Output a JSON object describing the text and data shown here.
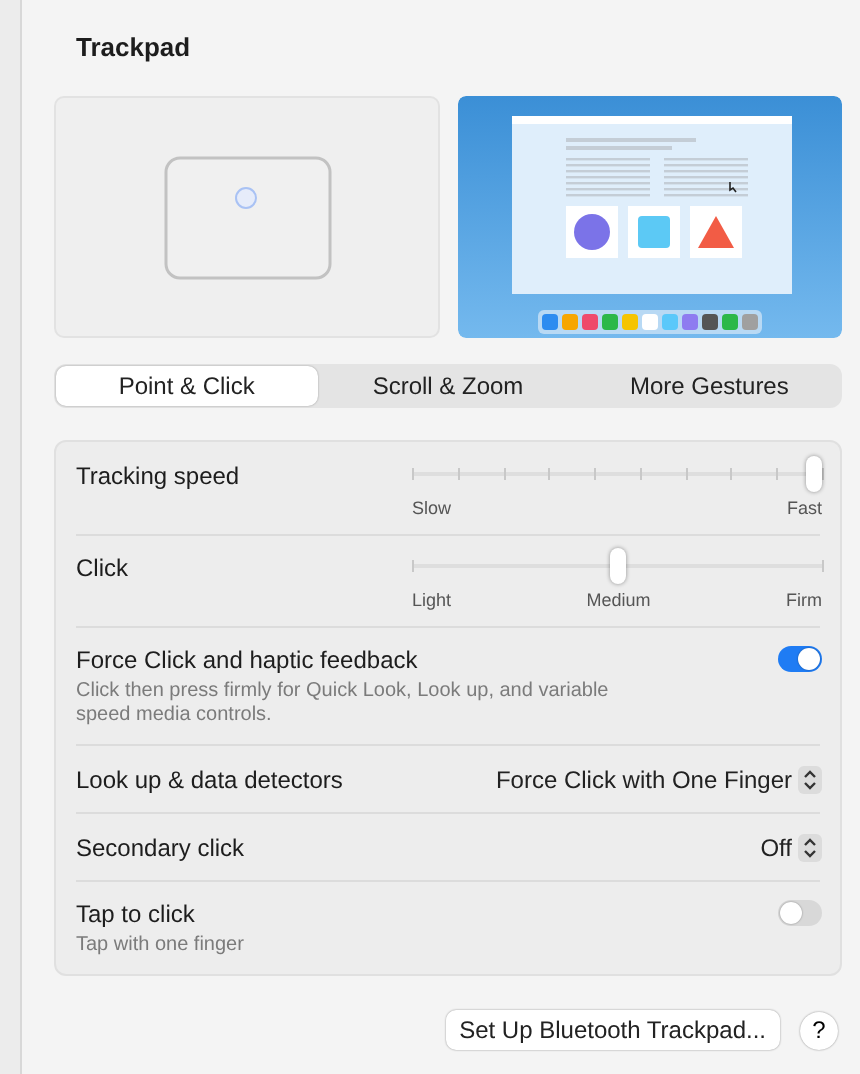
{
  "title": "Trackpad",
  "tabs": [
    {
      "label": "Point & Click",
      "selected": true
    },
    {
      "label": "Scroll & Zoom",
      "selected": false
    },
    {
      "label": "More Gestures",
      "selected": false
    }
  ],
  "settings": [
    {
      "kind": "slider",
      "label": "Tracking speed",
      "level": 1,
      "scale": [
        "Slow",
        "Fast"
      ]
    },
    {
      "kind": "slider",
      "label": "Click",
      "level": 0.5,
      "scale": [
        "Light",
        "Medium",
        "Firm"
      ]
    },
    {
      "kind": "toggle",
      "label": "Force Click and haptic feedback",
      "description": "Click then press firmly for Quick Look, Look up, and variable speed media controls.",
      "on": true
    },
    {
      "kind": "popup",
      "label": "Look up & data detectors",
      "value": "Force Click with One Finger"
    },
    {
      "kind": "popup",
      "label": "Secondary click",
      "value": "Off"
    },
    {
      "kind": "toggle",
      "label": "Tap to click",
      "description": "Tap with one finger",
      "on": false
    }
  ],
  "footer": {
    "button": "Set Up Bluetooth Trackpad...",
    "help": "?"
  }
}
